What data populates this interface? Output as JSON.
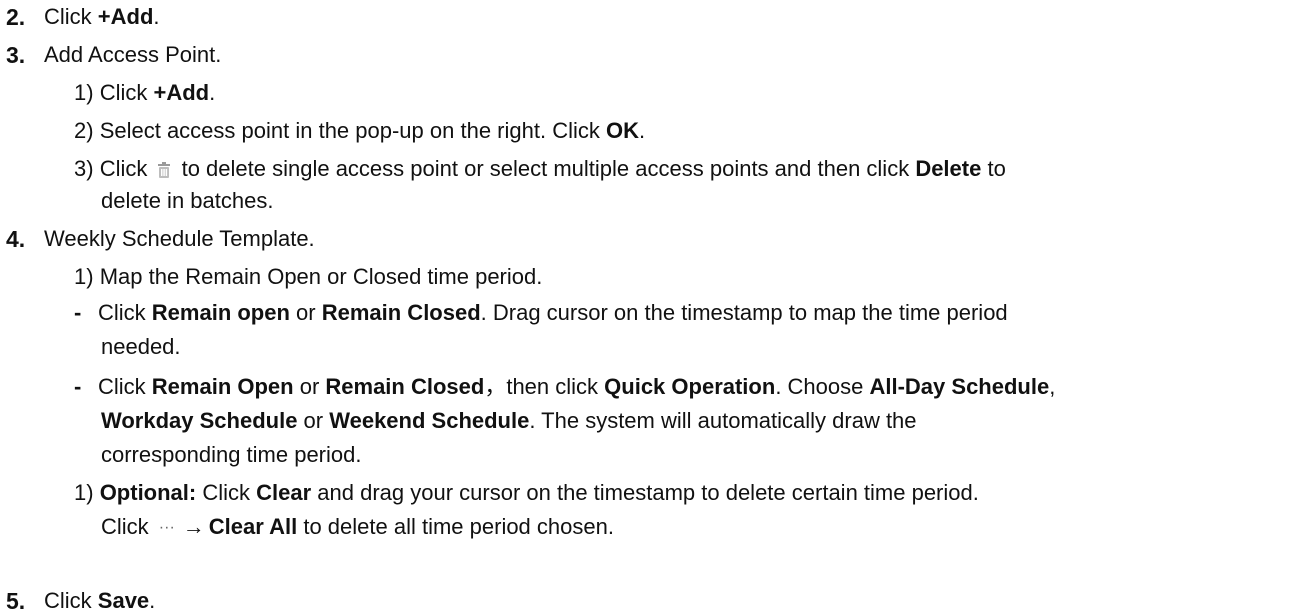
{
  "steps": {
    "s2": {
      "num": "2.",
      "pre": "Click ",
      "b1": "+Add",
      "post": "."
    },
    "s3": {
      "num": "3.",
      "text": "Add Access Point."
    },
    "s3_1": {
      "num": "1)",
      "pre": "Click ",
      "b1": "+Add",
      "post": "."
    },
    "s3_2": {
      "num": "2)",
      "pre": "Select access point in the pop-up on the right. Click ",
      "b1": "OK",
      "post": "."
    },
    "s3_3": {
      "num": "3)",
      "pre": "Click ",
      "mid": " to delete single access point or select multiple access points and then click ",
      "b1": "Delete",
      "post": " to",
      "cont": "delete in batches.",
      "icon": "trash-icon"
    },
    "s4": {
      "num": "4.",
      "text": "Weekly Schedule Template."
    },
    "s4_1": {
      "num": "1)",
      "text": "Map the Remain Open or Closed time period."
    },
    "s4_b1": {
      "bullet": "-",
      "pre": "Click ",
      "b1": "Remain open",
      "t1": " or ",
      "b2": "Remain Closed",
      "t2": ". Drag cursor on the timestamp to map the time period",
      "cont": "needed."
    },
    "s4_b2": {
      "bullet": "-",
      "pre": "Click ",
      "b1": "Remain Open",
      "t1": " or ",
      "b2": "Remain Closed",
      "t2": "，then click ",
      "b3": "Quick Operation",
      "t3": ". Choose ",
      "b4": "All-Day Schedule",
      "t4": ",",
      "l2b1": "Workday Schedule",
      "l2t1": " or ",
      "l2b2": "Weekend Schedule",
      "l2t2": ". The system will automatically draw the",
      "l3": "corresponding time period."
    },
    "s4_opt": {
      "num": "1)",
      "b0": "Optional:",
      "t0": " Click ",
      "b1": "Clear",
      "t1": " and drag your cursor on the timestamp to delete certain time period.",
      "l2pre": "Click ",
      "l2more": "···",
      "l2arrow": "→",
      "l2b1": "Clear All",
      "l2post": " to delete all time period chosen."
    },
    "s5": {
      "num": "5.",
      "pre": "Click ",
      "b1": "Save",
      "post": "."
    }
  }
}
